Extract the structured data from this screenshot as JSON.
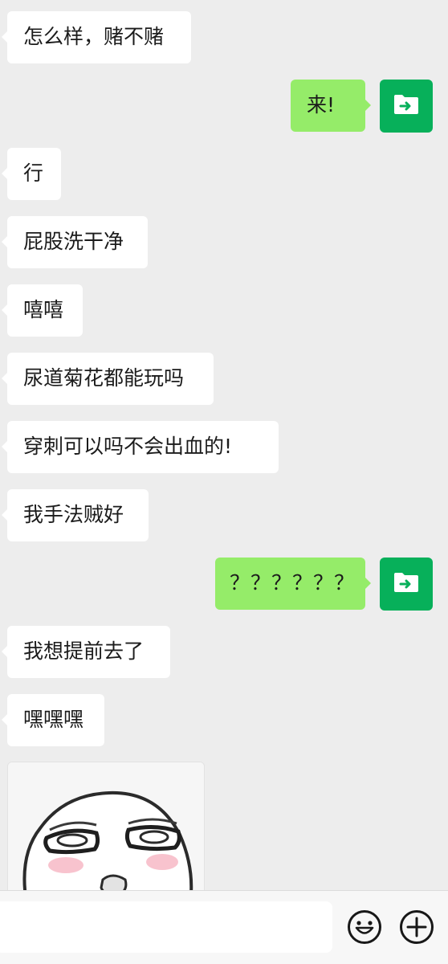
{
  "messages": [
    {
      "side": "in",
      "text": "怎么样，赌不赌"
    },
    {
      "side": "out",
      "text": "来!"
    },
    {
      "side": "in",
      "text": "行"
    },
    {
      "side": "in",
      "text": "屁股洗干净"
    },
    {
      "side": "in",
      "text": "嘻嘻"
    },
    {
      "side": "in",
      "text": "尿道菊花都能玩吗"
    },
    {
      "side": "in",
      "text": "穿刺可以吗不会出血的!"
    },
    {
      "side": "in",
      "text": "我手法贼好"
    },
    {
      "side": "out",
      "text": "？？？？？？"
    },
    {
      "side": "in",
      "text": "我想提前去了"
    },
    {
      "side": "in",
      "text": "嘿嘿嘿"
    }
  ],
  "avatar": {
    "icon": "folder-arrow-icon",
    "color": "#07b05a"
  },
  "sticker": {
    "type": "meme-face-sticker"
  },
  "input_bar": {
    "text_value": "",
    "emoji_icon": "smiley-face-icon",
    "plus_icon": "plus-circle-icon"
  },
  "colors": {
    "background": "#ededed",
    "incoming_bubble": "#ffffff",
    "outgoing_bubble": "#95ec69",
    "avatar": "#07b05a"
  }
}
